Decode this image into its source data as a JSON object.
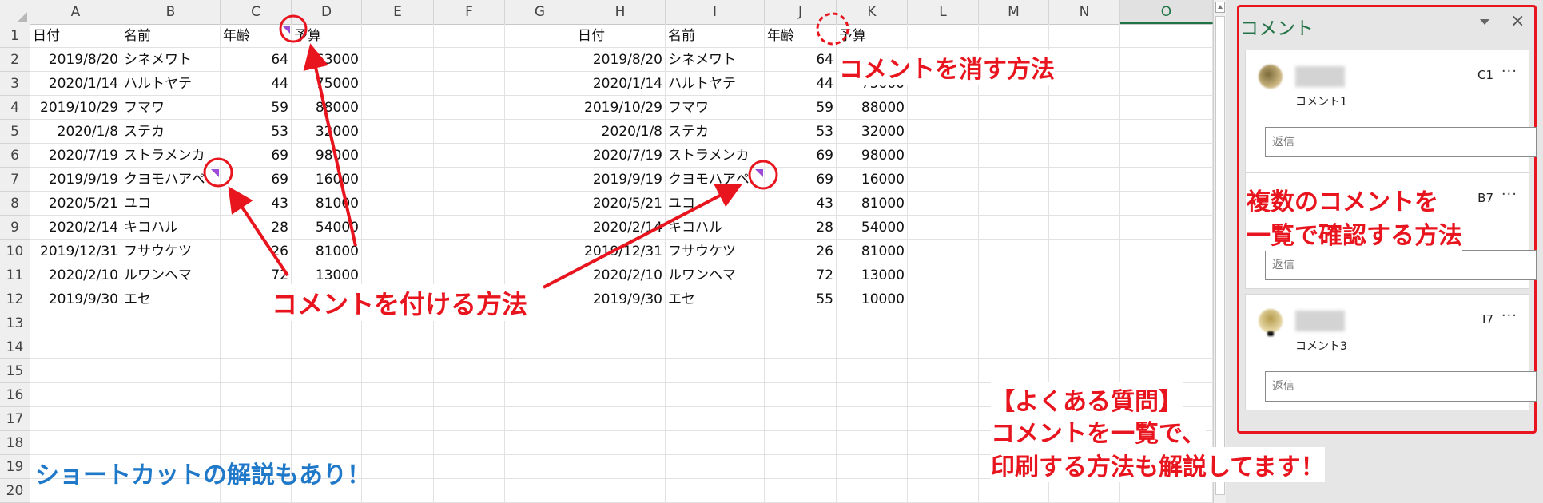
{
  "columns": [
    "A",
    "B",
    "C",
    "D",
    "E",
    "F",
    "G",
    "H",
    "I",
    "J",
    "K",
    "L",
    "M",
    "N",
    "O"
  ],
  "selected_column": "O",
  "rows": [
    "1",
    "2",
    "3",
    "4",
    "5",
    "6",
    "7",
    "8",
    "9",
    "10",
    "11",
    "12",
    "13",
    "14",
    "15",
    "16",
    "17",
    "18",
    "19",
    "20"
  ],
  "left_table": {
    "header": [
      "日付",
      "名前",
      "年齢",
      "予算"
    ],
    "rows": [
      [
        "2019/8/20",
        "シネメワト",
        "64",
        "63000"
      ],
      [
        "2020/1/14",
        "ハルトヤテ",
        "44",
        "75000"
      ],
      [
        "2019/10/29",
        "フマワ",
        "59",
        "88000"
      ],
      [
        "2020/1/8",
        "ステカ",
        "53",
        "32000"
      ],
      [
        "2020/7/19",
        "ストラメンカ",
        "69",
        "98000"
      ],
      [
        "2019/9/19",
        "クヨモハアペ",
        "69",
        "16000"
      ],
      [
        "2020/5/21",
        "ユコ",
        "43",
        "81000"
      ],
      [
        "2020/2/14",
        "キコハル",
        "28",
        "54000"
      ],
      [
        "2019/12/31",
        "フサウケツ",
        "26",
        "81000"
      ],
      [
        "2020/2/10",
        "ルワンヘマ",
        "72",
        "13000"
      ],
      [
        "2019/9/30",
        "エセ",
        "55",
        "10000"
      ]
    ]
  },
  "right_table": {
    "header": [
      "日付",
      "名前",
      "年齢",
      "予算"
    ],
    "rows": [
      [
        "2019/8/20",
        "シネメワト",
        "64",
        "63000"
      ],
      [
        "2020/1/14",
        "ハルトヤテ",
        "44",
        "75000"
      ],
      [
        "2019/10/29",
        "フマワ",
        "59",
        "88000"
      ],
      [
        "2020/1/8",
        "ステカ",
        "53",
        "32000"
      ],
      [
        "2020/7/19",
        "ストラメンカ",
        "69",
        "98000"
      ],
      [
        "2019/9/19",
        "クヨモハアペ",
        "69",
        "16000"
      ],
      [
        "2020/5/21",
        "ユコ",
        "43",
        "81000"
      ],
      [
        "2020/2/14",
        "キコハル",
        "28",
        "54000"
      ],
      [
        "2019/12/31",
        "フサウケツ",
        "26",
        "81000"
      ],
      [
        "2020/2/10",
        "ルワンヘマ",
        "72",
        "13000"
      ],
      [
        "2019/9/30",
        "エセ",
        "55",
        "10000"
      ]
    ]
  },
  "annotations": {
    "delete_comment": "コメントを消す方法",
    "add_comment": "コメントを付ける方法",
    "list_comments_line1": "複数のコメントを",
    "list_comments_line2": "一覧で確認する方法",
    "shortcut": "ショートカットの解説もあり！",
    "faq_line1": "【よくある質問】",
    "faq_line2": "コメントを一覧で、",
    "faq_line3": "印刷する方法も解説してます！"
  },
  "comment_pane": {
    "title": "コメント",
    "close_glyph": "×",
    "more_glyph": "···",
    "reply_placeholder": "返信",
    "comments": [
      {
        "cell": "C1",
        "text": "コメント1"
      },
      {
        "cell": "B7",
        "text": "コメント2"
      },
      {
        "cell": "I7",
        "text": "コメント3"
      }
    ]
  },
  "colors": {
    "annotation_red": "#e8141e",
    "annotation_blue": "#1f78c8",
    "excel_green": "#217346",
    "comment_flag": "#9b4bd6"
  }
}
